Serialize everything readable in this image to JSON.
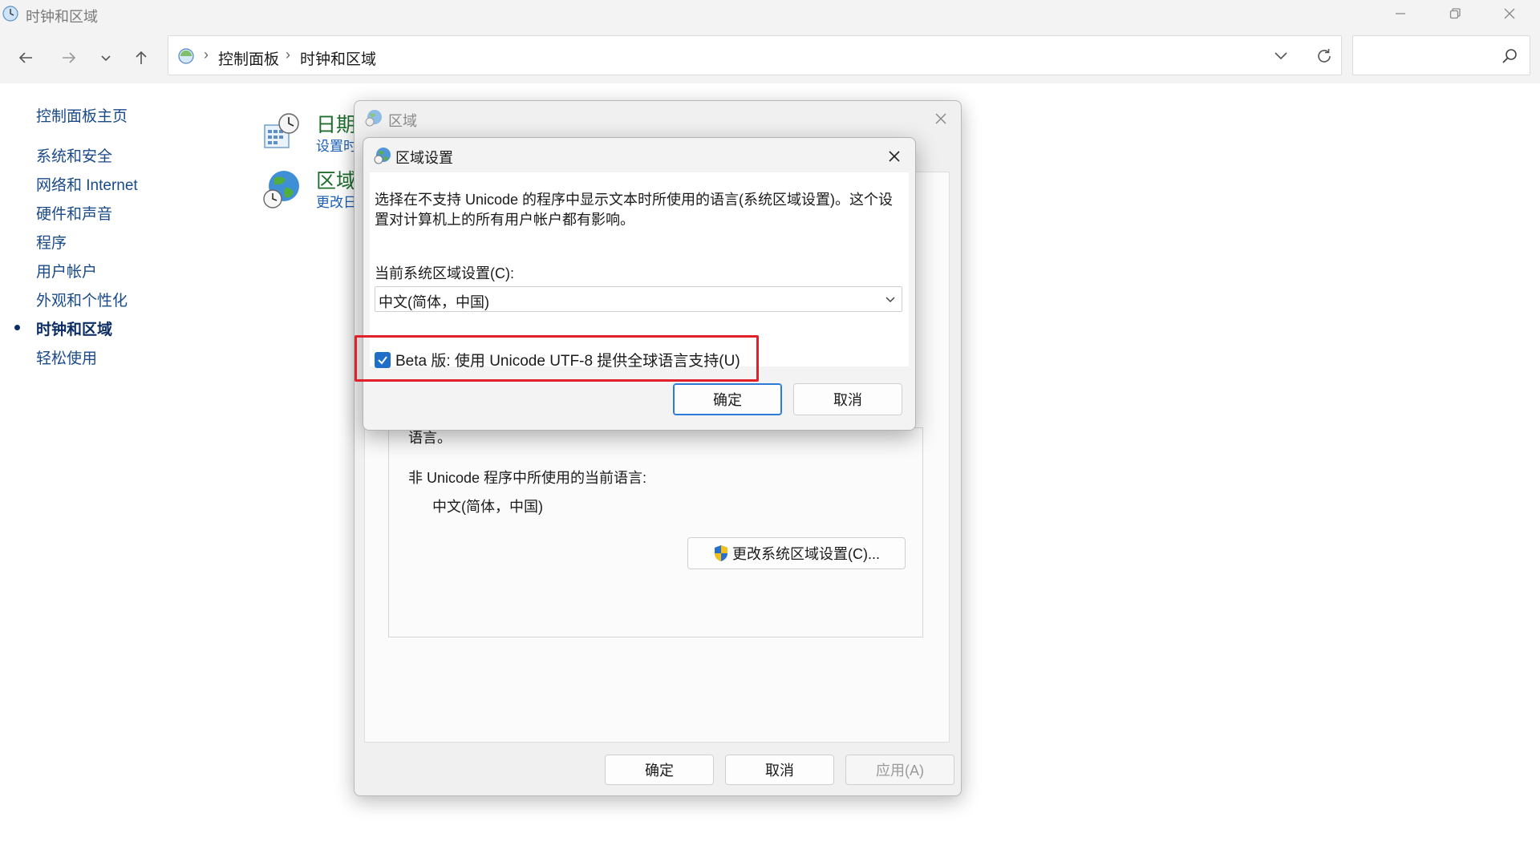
{
  "window": {
    "title": "时钟和区域",
    "icon": "clock-globe-icon"
  },
  "nav": {
    "breadcrumb": [
      "控制面板",
      "时钟和区域"
    ],
    "search_placeholder": ""
  },
  "left_nav": {
    "home": "控制面板主页",
    "items": [
      {
        "label": "系统和安全",
        "active": false
      },
      {
        "label": "网络和 Internet",
        "active": false
      },
      {
        "label": "硬件和声音",
        "active": false
      },
      {
        "label": "程序",
        "active": false
      },
      {
        "label": "用户帐户",
        "active": false
      },
      {
        "label": "外观和个性化",
        "active": false
      },
      {
        "label": "时钟和区域",
        "active": true
      },
      {
        "label": "轻松使用",
        "active": false
      }
    ]
  },
  "categories": [
    {
      "title": "日期",
      "subtitle": "设置时",
      "icon": "calendar-clock-icon"
    },
    {
      "title": "区域",
      "subtitle": "更改日",
      "icon": "globe-clock-icon"
    }
  ],
  "region_dialog": {
    "title": "区域",
    "admin_tail": "语言。",
    "non_unicode_label": "非 Unicode 程序中所使用的当前语言:",
    "non_unicode_value": "中文(简体，中国)",
    "change_locale_button": "更改系统区域设置(C)...",
    "ok_button": "确定",
    "cancel_button": "取消",
    "apply_button": "应用(A)"
  },
  "settings_dialog": {
    "title": "区域设置",
    "description": "选择在不支持 Unicode 的程序中显示文本时所使用的语言(系统区域设置)。这个设置对计算机上的所有用户帐户都有影响。",
    "current_label": "当前系统区域设置(C):",
    "current_value": "中文(简体，中国)",
    "beta_label": "Beta 版: 使用 Unicode UTF-8 提供全球语言支持(U)",
    "beta_checked": true,
    "ok_button": "确定",
    "cancel_button": "取消"
  },
  "colors": {
    "highlight": "#e0202a",
    "link": "#1a4a8a",
    "category_title": "#1f6e2e",
    "check_accent": "#1f6fc9"
  }
}
